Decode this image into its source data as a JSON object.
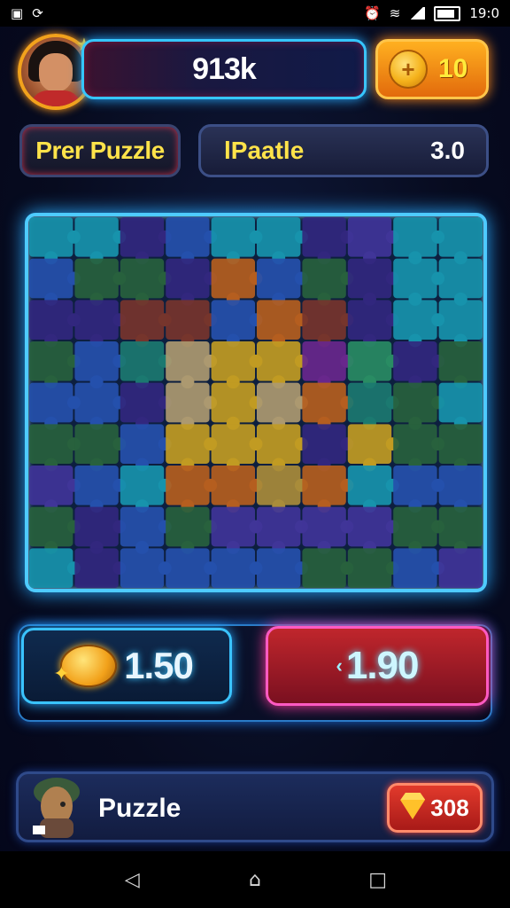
{
  "status_bar": {
    "time": "19:0",
    "icons": [
      "gallery-icon",
      "sync-icon",
      "alarm-icon",
      "wifi-icon",
      "signal-icon",
      "battery-icon"
    ]
  },
  "header": {
    "score": "913k",
    "coins": "10"
  },
  "mode": {
    "tab_label": "Prer Puzzle",
    "puzzle_name": "lPaatle",
    "puzzle_level": "3.0"
  },
  "board": {
    "rows": 9,
    "cols": 10,
    "accent": "#4ecbff"
  },
  "actions": {
    "left_value": "1.50",
    "right_value": "1.90",
    "right_arrow": "‹"
  },
  "player": {
    "name": "Puzzle",
    "gems": "308"
  },
  "colors": {
    "neon_blue": "#35c6ff",
    "neon_pink": "#ff5ac2",
    "gold": "#ffe34a",
    "orange": "#f5a21c"
  }
}
